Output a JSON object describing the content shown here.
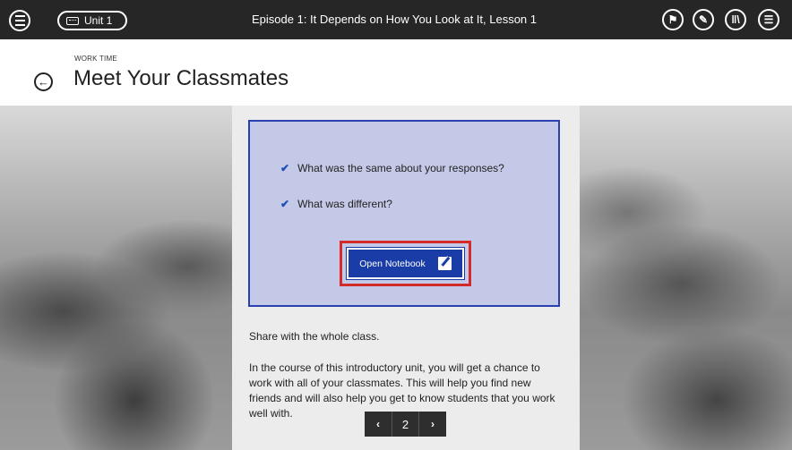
{
  "topbar": {
    "unit_label": "Unit 1",
    "episode_title": "Episode 1: It Depends on How You Look at It, Lesson 1",
    "icons": [
      "menu-icon",
      "unit-icon",
      "tools-icon",
      "pen-icon",
      "library-icon",
      "notes-icon"
    ]
  },
  "header": {
    "eyebrow": "WORK TIME",
    "title": "Meet Your Classmates"
  },
  "prompt": {
    "items": [
      "What was the same about your responses?",
      "What was different?"
    ],
    "button_label": "Open Notebook"
  },
  "content": {
    "share": "Share with the whole class.",
    "paragraph": "In the course of this introductory unit, you will get a chance to work with all of your classmates. This will help you find new friends and will also help you get to know students that you work well with."
  },
  "pager": {
    "prev": "‹",
    "page": "2",
    "next": "›"
  },
  "colors": {
    "topbar": "#262626",
    "prompt_bg": "#c3c9e6",
    "prompt_border": "#2a3fb0",
    "button_bg": "#1a3ca6",
    "highlight": "#d32a2a"
  }
}
